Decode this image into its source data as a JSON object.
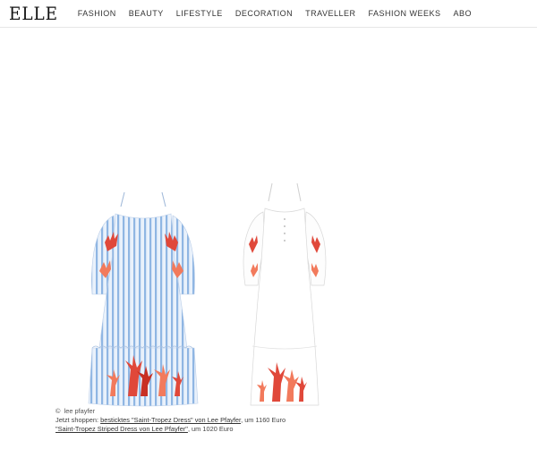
{
  "header": {
    "logo": "ELLE",
    "nav": [
      "FASHION",
      "BEAUTY",
      "LIFESTYLE",
      "DECORATION",
      "TRAVELLER",
      "FASHION WEEKS",
      "ABO"
    ]
  },
  "caption": {
    "credit_symbol": "©",
    "credit": "lee pfayfer",
    "line1_prefix": "Jetzt shoppen: ",
    "link1": "besticktes \"Saint-Tropez Dress\" von Lee Pfayfer",
    "line1_suffix": ", um  1160 Euro",
    "link2": "\"Saint-Tropez Striped Dress von Lee Pfayfer\"",
    "line2_suffix": ", um 1020 Euro"
  },
  "colors": {
    "stripe_blue": "#8fb6e3",
    "coral": "#e0483a",
    "coral_light": "#f27a5c",
    "dress_white": "#ffffff"
  }
}
